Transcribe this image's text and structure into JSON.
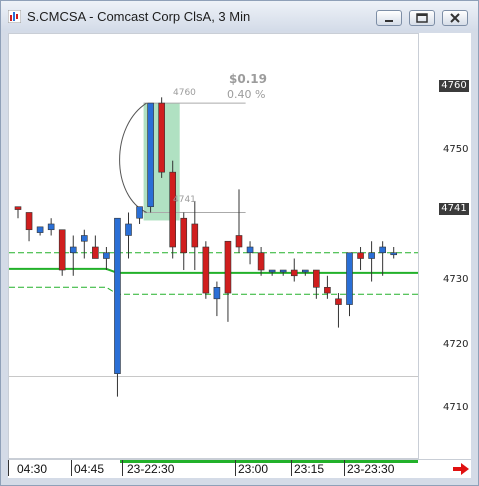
{
  "window": {
    "title": "S.CMCSA - Comcast Corp ClsA, 3 Min",
    "icon": "chart-app-icon",
    "buttons": [
      "minimize",
      "maximize",
      "close"
    ]
  },
  "measure": {
    "change": "$0.19",
    "percent": "0.40 %",
    "start_label": "4760",
    "end_label": "4741"
  },
  "price_axis": {
    "ticks": [
      "4750",
      "4730",
      "4720",
      "4710"
    ],
    "highlight_top": "4760",
    "highlight_bottom": "4741"
  },
  "time_axis": {
    "labels": [
      "04:30",
      "04:45",
      "23-22:30",
      "23:00",
      "23:15",
      "23-23:30"
    ]
  },
  "colors": {
    "up": "#2a6fd6",
    "down": "#d01e1e",
    "ma": "#22b12a",
    "grid": "#c8c8c8",
    "highlight": "#8fd4a8"
  },
  "chart_data": {
    "type": "candlestick",
    "ylim": [
      4698,
      4772
    ],
    "reference_line": 4712.5,
    "candles": [
      {
        "o": 4742,
        "h": 4742,
        "l": 4740,
        "c": 4741.5
      },
      {
        "o": 4741,
        "h": 4741,
        "l": 4736,
        "c": 4738
      },
      {
        "o": 4737.5,
        "h": 4738.5,
        "l": 4737,
        "c": 4738.5
      },
      {
        "o": 4738,
        "h": 4740,
        "l": 4737,
        "c": 4739
      },
      {
        "o": 4738,
        "h": 4738,
        "l": 4730,
        "c": 4731
      },
      {
        "o": 4734,
        "h": 4737,
        "l": 4730,
        "c": 4735
      },
      {
        "o": 4736,
        "h": 4738,
        "l": 4733,
        "c": 4737
      },
      {
        "o": 4735,
        "h": 4737,
        "l": 4733,
        "c": 4733
      },
      {
        "o": 4733,
        "h": 4735,
        "l": 4731,
        "c": 4734
      },
      {
        "o": 4713,
        "h": 4740,
        "l": 4709,
        "c": 4740
      },
      {
        "o": 4737,
        "h": 4741,
        "l": 4733,
        "c": 4739
      },
      {
        "o": 4740,
        "h": 4742,
        "l": 4739,
        "c": 4742
      },
      {
        "o": 4742,
        "h": 4760,
        "l": 4741,
        "c": 4760
      },
      {
        "o": 4760,
        "h": 4761,
        "l": 4747,
        "c": 4748
      },
      {
        "o": 4748,
        "h": 4750,
        "l": 4733,
        "c": 4735
      },
      {
        "o": 4740,
        "h": 4741,
        "l": 4731,
        "c": 4734
      },
      {
        "o": 4739,
        "h": 4743,
        "l": 4731,
        "c": 4735
      },
      {
        "o": 4735,
        "h": 4736,
        "l": 4726,
        "c": 4727
      },
      {
        "o": 4726,
        "h": 4729,
        "l": 4723,
        "c": 4728
      },
      {
        "o": 4736,
        "h": 4736,
        "l": 4722,
        "c": 4727
      },
      {
        "o": 4737,
        "h": 4745,
        "l": 4734,
        "c": 4735
      },
      {
        "o": 4734,
        "h": 4736,
        "l": 4732,
        "c": 4735
      },
      {
        "o": 4734,
        "h": 4735,
        "l": 4730,
        "c": 4731
      },
      {
        "o": 4731,
        "h": 4731,
        "l": 4730,
        "c": 4731
      },
      {
        "o": 4731,
        "h": 4731,
        "l": 4730,
        "c": 4731
      },
      {
        "o": 4731,
        "h": 4733,
        "l": 4729,
        "c": 4730
      },
      {
        "o": 4731,
        "h": 4731,
        "l": 4730,
        "c": 4731
      },
      {
        "o": 4731,
        "h": 4731,
        "l": 4726,
        "c": 4728
      },
      {
        "o": 4728,
        "h": 4730,
        "l": 4726,
        "c": 4727
      },
      {
        "o": 4726,
        "h": 4727,
        "l": 4721,
        "c": 4725
      },
      {
        "o": 4725,
        "h": 4734,
        "l": 4723,
        "c": 4734
      },
      {
        "o": 4734,
        "h": 4735,
        "l": 4731,
        "c": 4733
      },
      {
        "o": 4733,
        "h": 4736,
        "l": 4729,
        "c": 4734
      },
      {
        "o": 4734,
        "h": 4736,
        "l": 4730,
        "c": 4735
      },
      {
        "o": 4734,
        "h": 4735,
        "l": 4733,
        "c": 4734
      }
    ],
    "lines": {
      "ma_upper": [
        4734,
        4734,
        4734,
        4734,
        4734,
        4734,
        4734,
        4734,
        4734,
        4734,
        4734,
        4734,
        4734,
        4734,
        4734,
        4734,
        4734,
        4734,
        4734,
        4734,
        4734,
        4734,
        4734,
        4734,
        4734,
        4734,
        4734,
        4734,
        4734,
        4734,
        4734,
        4734,
        4734,
        4734,
        4734
      ],
      "ma_mid": [
        4731.2,
        4731.2,
        4731.2,
        4731.2,
        4731.2,
        4731.2,
        4731.2,
        4731.2,
        4731.2,
        4730.5,
        4730.5,
        4730.5,
        4730.5,
        4730.5,
        4730.5,
        4730.5,
        4730.5,
        4730.5,
        4730.5,
        4730.5,
        4730.5,
        4730.5,
        4730.5,
        4730.5,
        4730.5,
        4730.5,
        4730.5,
        4730.5,
        4730.5,
        4730.5,
        4730.5,
        4730.5,
        4730.5,
        4730.5,
        4730.5
      ],
      "ma_lower": [
        4728,
        4728,
        4728,
        4728,
        4728,
        4728,
        4728,
        4728,
        4728,
        4726.8,
        4726.8,
        4726.8,
        4726.8,
        4726.8,
        4726.8,
        4726.8,
        4726.8,
        4726.8,
        4726.8,
        4726.8,
        4726.8,
        4726.8,
        4726.8,
        4726.8,
        4726.8,
        4726.8,
        4726.8,
        4726.8,
        4726.8,
        4726.8,
        4726.8,
        4726.8,
        4726.8,
        4726.8,
        4726.8
      ]
    }
  }
}
